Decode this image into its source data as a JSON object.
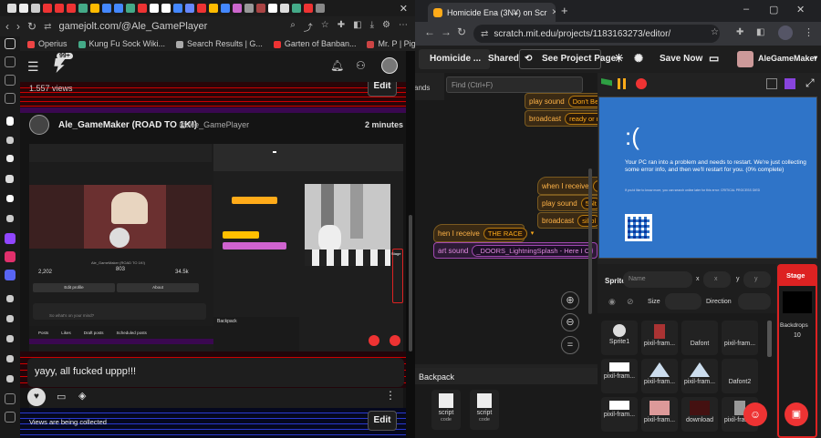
{
  "left_browser": {
    "url": "gamejolt.com/@Ale_GamePlayer",
    "bookmarks": [
      "Operius",
      "Kung Fu Sock Wiki...",
      "Search Results | G...",
      "Garten of Banban...",
      "Mr. P | Piggy Wiki..."
    ],
    "notification_badge": "99+",
    "views_label": "1.557 views",
    "edit_label": "Edit",
    "post_author": "Ale_GameMaker (ROAD TO 1K!)",
    "post_handle": "@Ale_GamePlayer",
    "post_time": "2 minutes",
    "comment_text": "yayy, all fucked uppp!!!",
    "views_collecting": "Views are being collected",
    "edit_label_bottom": "Edit",
    "thumb": {
      "profile_stats": [
        "2,202",
        "803",
        "34.5k"
      ],
      "profile_name": "Ale_GameMaker (ROAD TO 1K!)",
      "edit_profile": "Edit profile",
      "about": "About",
      "compose": "So what's on your mind?",
      "tabs": [
        "Posts",
        "Likes",
        "Draft posts",
        "Scheduled posts"
      ],
      "backpack_label": "Backpack",
      "stage_label": "Stage"
    }
  },
  "right_browser": {
    "tab_title": "Homicide Ena (3N¥) on Scr",
    "url": "scratch.mit.edu/projects/1183163273/editor/",
    "project_title": "Homicide ...",
    "shared_label": "Shared",
    "see_project_label": "See Project Page",
    "save_now_label": "Save Now",
    "user_name": "AleGameMaker",
    "tab_fragment": "ands",
    "find_placeholder": "Find (Ctrl+F)",
    "blocks": {
      "play_sound": "play sound",
      "sound_1": "Don't Be",
      "broadcast": "broadcast",
      "msg_1": "ready or n",
      "when_receive": "when I receive",
      "when_receive_short": "hen I receive",
      "msg_2": "a",
      "sound_2": "55lt",
      "msg_3": "sil bl",
      "the_race": "THE RACE",
      "start_sound": "art sound",
      "sound_3": "_DOORS_LightningSplash - Here I Come _D..."
    },
    "bsod": {
      "face": ":(",
      "message": "Your PC ran into a problem and needs to restart. We're just collecting some error info, and then we'll restart for you. (0% complete)",
      "fine_print": "If you'd like to know more, you can search online later for this error: CRITICAL PROCESS DIED"
    },
    "sprite_panel": {
      "sprite_label": "Sprite",
      "name_placeholder": "Name",
      "x_label": "x",
      "y_label": "y",
      "size_label": "Size",
      "direction_label": "Direction",
      "sprites": [
        "Sprite1",
        "pixil-fram...",
        "Dafont",
        "pixil-fram...",
        "pixil-fram...",
        "pixil-fram...",
        "pixil-fram...",
        "Dafont2",
        "pixil-fram...",
        "pixil-fram...",
        "download",
        "pixil-fram..."
      ]
    },
    "stage_panel": {
      "label": "Stage",
      "backdrops_label": "Backdrops",
      "backdrops_count": "10"
    },
    "backpack": {
      "label": "Backpack",
      "items": [
        "script",
        "script"
      ],
      "item_sub": [
        "code",
        "code"
      ]
    }
  },
  "colors": {
    "scratch_orange": "#ffab19",
    "event_yellow": "#ffbf00",
    "sound_purple": "#cf63cf",
    "bsod_blue": "#2f74c8",
    "stage_red": "#d22222"
  }
}
